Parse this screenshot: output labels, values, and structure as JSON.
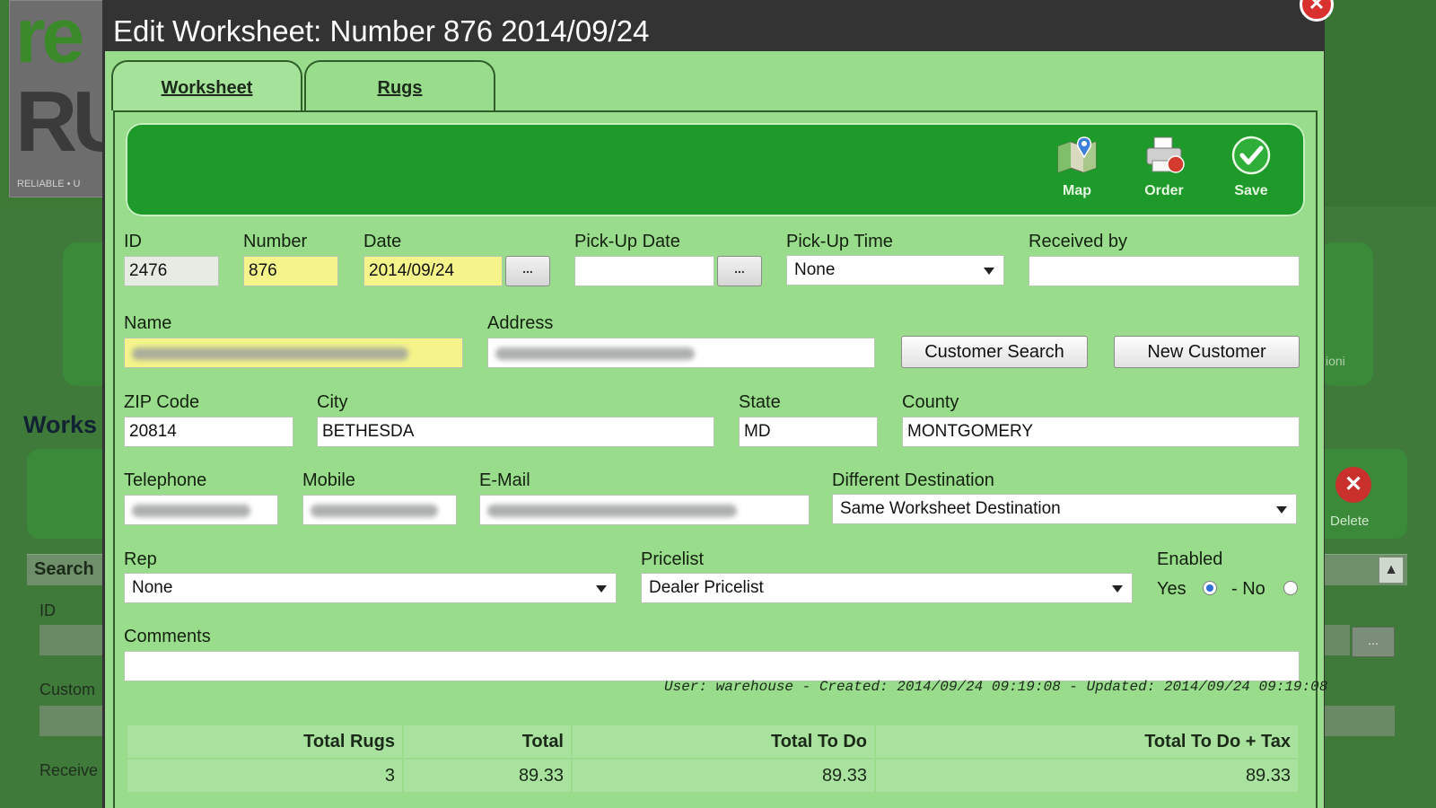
{
  "background": {
    "logo_re": "re",
    "logo_ru": "RU",
    "logo_tagline": "RELIABLE • U",
    "section_title": "Works",
    "search_label": "Search",
    "field_id": "ID",
    "field_customer": "Custom",
    "field_received": "Receive",
    "delete_label": "Delete",
    "ghost_label": "zioni",
    "dots": "..."
  },
  "modal": {
    "title": "Edit Worksheet: Number 876 2014/09/24",
    "close_symbol": "✕",
    "tabs": [
      {
        "label": "Worksheet",
        "active": true
      },
      {
        "label": "Rugs",
        "active": false
      }
    ],
    "toolbar": [
      {
        "label": "Map",
        "icon": "map-icon"
      },
      {
        "label": "Order",
        "icon": "printer-icon"
      },
      {
        "label": "Save",
        "icon": "check-icon"
      }
    ],
    "fields": {
      "id": {
        "label": "ID",
        "value": "2476"
      },
      "number": {
        "label": "Number",
        "value": "876"
      },
      "date": {
        "label": "Date",
        "value": "2014/09/24"
      },
      "pickup_date": {
        "label": "Pick-Up Date",
        "value": ""
      },
      "pickup_time": {
        "label": "Pick-Up Time",
        "value": "None"
      },
      "received_by": {
        "label": "Received by",
        "value": ""
      },
      "name": {
        "label": "Name"
      },
      "address": {
        "label": "Address"
      },
      "zip": {
        "label": "ZIP Code",
        "value": "20814"
      },
      "city": {
        "label": "City",
        "value": "BETHESDA"
      },
      "state": {
        "label": "State",
        "value": "MD"
      },
      "county": {
        "label": "County",
        "value": "MONTGOMERY"
      },
      "telephone": {
        "label": "Telephone"
      },
      "mobile": {
        "label": "Mobile"
      },
      "email": {
        "label": "E-Mail"
      },
      "destination": {
        "label": "Different Destination",
        "value": "Same Worksheet Destination"
      },
      "rep": {
        "label": "Rep",
        "value": "None"
      },
      "pricelist": {
        "label": "Pricelist",
        "value": "Dealer Pricelist"
      },
      "enabled": {
        "label": "Enabled",
        "yes": "Yes",
        "no": "- No",
        "selected": "yes"
      },
      "comments": {
        "label": "Comments",
        "value": ""
      }
    },
    "dots": "...",
    "buttons": {
      "customer_search": "Customer Search",
      "new_customer": "New Customer"
    },
    "audit": "User: warehouse - Created: 2014/09/24 09:19:08 - Updated: 2014/09/24 09:19:08",
    "totals": {
      "headers": [
        "Total Rugs",
        "Total",
        "Total To Do",
        "Total To Do + Tax"
      ],
      "values": [
        "3",
        "89.33",
        "89.33",
        "89.33"
      ]
    }
  },
  "colors": {
    "modal_bg": "#98dc8c",
    "toolbar_bg": "#1e9a2a",
    "required_field": "#f4f48a",
    "title_bar": "#333333"
  }
}
